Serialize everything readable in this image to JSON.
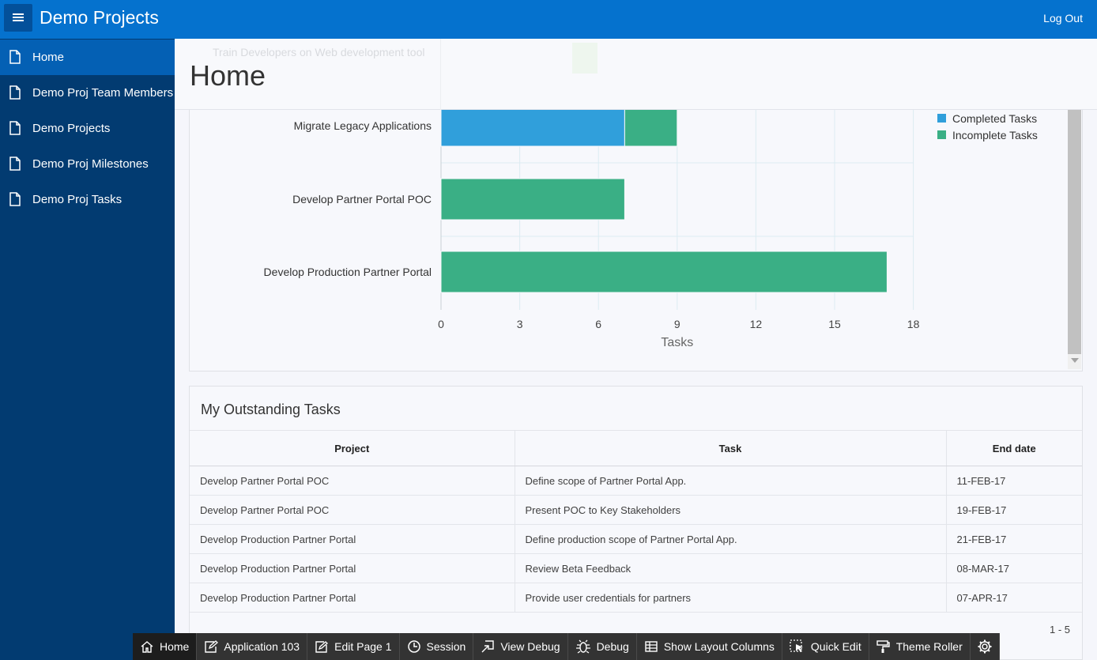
{
  "header": {
    "app_title": "Demo Projects",
    "logout_label": "Log Out"
  },
  "sidebar": {
    "items": [
      {
        "label": "Home",
        "active": true
      },
      {
        "label": "Demo Proj Team Members"
      },
      {
        "label": "Demo Projects"
      },
      {
        "label": "Demo Proj Milestones"
      },
      {
        "label": "Demo Proj Tasks"
      }
    ]
  },
  "page": {
    "title": "Home",
    "ghost_text": "Train Developers on Web development tool"
  },
  "chart_data": {
    "type": "bar",
    "orientation": "horizontal",
    "stacked": true,
    "categories": [
      "Migrate Legacy Applications",
      "Develop Partner Portal POC",
      "Develop Production Partner Portal"
    ],
    "series": [
      {
        "name": "Completed Tasks",
        "color": "#309fdb",
        "values": [
          7,
          0,
          0
        ]
      },
      {
        "name": "Incomplete Tasks",
        "color": "#3aaf85",
        "values": [
          2,
          7,
          17
        ]
      }
    ],
    "xlabel": "Tasks",
    "xlim": [
      0,
      18
    ],
    "xticks": [
      "0",
      "3",
      "6",
      "9",
      "12",
      "15",
      "18"
    ],
    "grid": true,
    "legend": "top-right"
  },
  "outstanding_tasks": {
    "title": "My Outstanding Tasks",
    "columns": [
      "Project",
      "Task",
      "End date"
    ],
    "rows": [
      [
        "Develop Partner Portal POC",
        "Define scope of Partner Portal App.",
        "11-FEB-17"
      ],
      [
        "Develop Partner Portal POC",
        "Present POC to Key Stakeholders",
        "19-FEB-17"
      ],
      [
        "Develop Production Partner Portal",
        "Define production scope of Partner Portal App.",
        "21-FEB-17"
      ],
      [
        "Develop Production Partner Portal",
        "Review Beta Feedback",
        "08-MAR-17"
      ],
      [
        "Develop Production Partner Portal",
        "Provide user credentials for partners",
        "07-APR-17"
      ]
    ],
    "pagination": "1 - 5"
  },
  "devbar": {
    "items": [
      {
        "label": "Home",
        "icon": "home-icon"
      },
      {
        "label": "Application 103",
        "icon": "edit-icon"
      },
      {
        "label": "Edit Page 1",
        "icon": "pencil-icon"
      },
      {
        "label": "Session",
        "icon": "clock-icon"
      },
      {
        "label": "View Debug",
        "icon": "view-debug-icon"
      },
      {
        "label": "Debug",
        "icon": "bug-icon"
      },
      {
        "label": "Show Layout Columns",
        "icon": "grid-icon"
      },
      {
        "label": "Quick Edit",
        "icon": "quick-edit-icon"
      },
      {
        "label": "Theme Roller",
        "icon": "paint-roller-icon"
      },
      {
        "label": "",
        "icon": "gear-icon"
      }
    ]
  }
}
